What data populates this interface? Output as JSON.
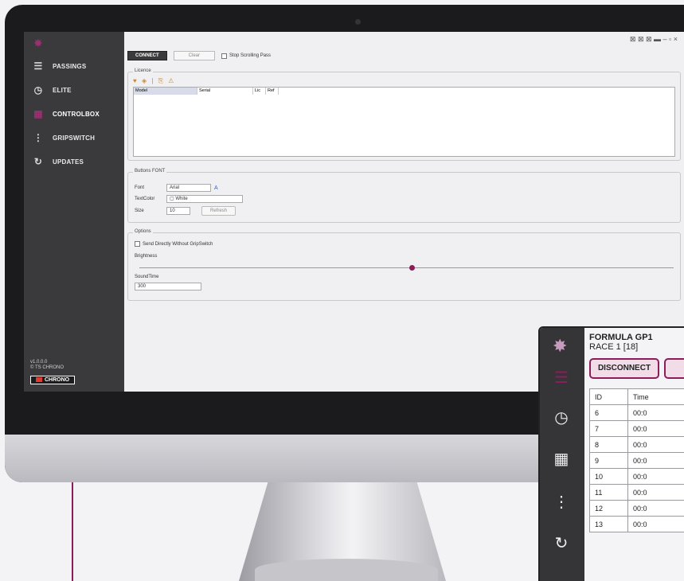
{
  "desktop_app": {
    "brand_mark": "✸",
    "nav": [
      {
        "label": "PASSINGS",
        "icon": "☰"
      },
      {
        "label": "ELITE",
        "icon": "◷"
      },
      {
        "label": "CONTROLBOX",
        "icon": "▦"
      },
      {
        "label": "GRIPSWITCH",
        "icon": "⋮"
      },
      {
        "label": "UPDATES",
        "icon": "↻"
      }
    ],
    "version_line1": "v1.0.0.0",
    "version_line2": "© TS CHRONO",
    "chrono_logo": "CHRONO",
    "titlebar_icons": "⊠ ⊠ ⊠ ▬  –  ▫  ×",
    "toolbar": {
      "connect": "CONNECT",
      "clear": "Clear",
      "stop_scrolling": "Stop Scrolling Pass"
    },
    "licence": {
      "title": "Licence",
      "columns": [
        "Model",
        "Serial",
        "Lic",
        "Ref"
      ]
    },
    "buttons_font": {
      "title": "Buttons FONT",
      "font_label": "Font",
      "font_value": "Arial",
      "textcolor_label": "TextColor",
      "textcolor_value": "White",
      "size_label": "Size",
      "size_value": "10",
      "refresh": "Refresh"
    },
    "options": {
      "title": "Options",
      "send_directly": "Send Directly Without GripSwitch",
      "brightness": "Brightness",
      "brightness_value": 0.51,
      "soundtime_label": "SoundTime",
      "soundtime_value": "300"
    }
  },
  "mobile_app": {
    "title": "FORMULA GP1",
    "subtitle": "RACE 1 [18]",
    "disconnect": "DISCONNECT",
    "table_headers": [
      "ID",
      "Time"
    ],
    "rows": [
      {
        "id": "6",
        "time": "00:0"
      },
      {
        "id": "7",
        "time": "00:0"
      },
      {
        "id": "8",
        "time": "00:0"
      },
      {
        "id": "9",
        "time": "00:0"
      },
      {
        "id": "10",
        "time": "00:0"
      },
      {
        "id": "11",
        "time": "00:0"
      },
      {
        "id": "12",
        "time": "00:0"
      },
      {
        "id": "13",
        "time": "00:0"
      }
    ]
  },
  "colors": {
    "brand": "#8c1d5c",
    "sidebar": "#3a3a3d"
  }
}
